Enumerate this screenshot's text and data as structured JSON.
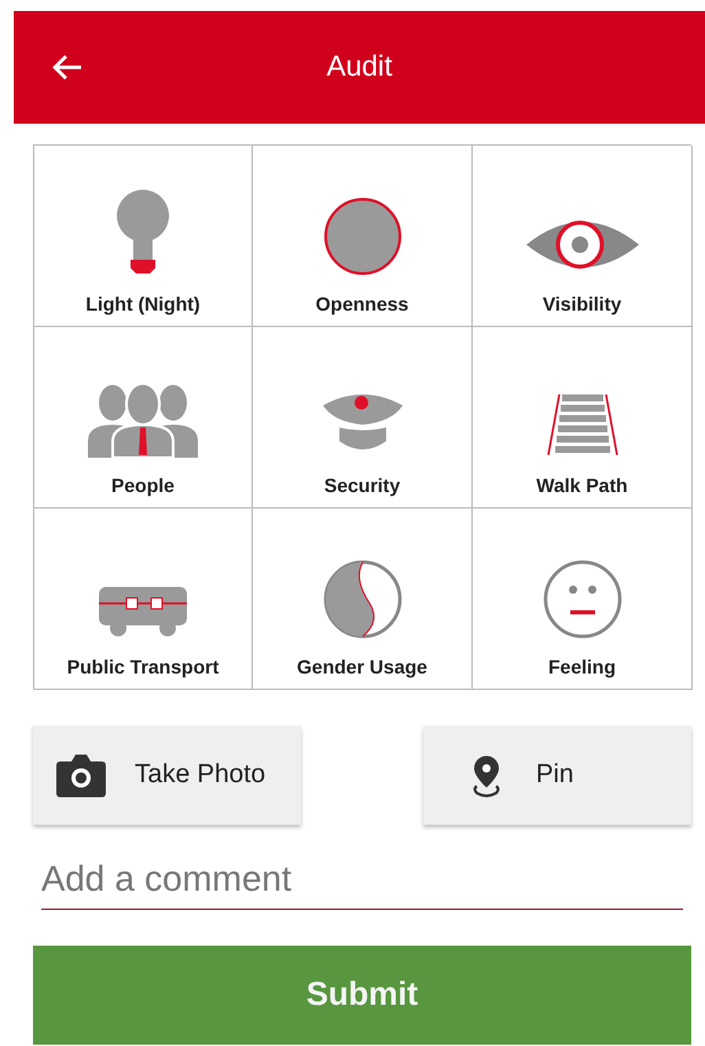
{
  "header": {
    "title": "Audit"
  },
  "categories": [
    {
      "label": "Light (Night)",
      "kind": "bulb"
    },
    {
      "label": "Openness",
      "kind": "circle"
    },
    {
      "label": "Visibility",
      "kind": "eye"
    },
    {
      "label": "People",
      "kind": "people"
    },
    {
      "label": "Security",
      "kind": "cap"
    },
    {
      "label": "Walk Path",
      "kind": "path"
    },
    {
      "label": "Public Transport",
      "kind": "bus"
    },
    {
      "label": "Gender Usage",
      "kind": "yinyang"
    },
    {
      "label": "Feeling",
      "kind": "face"
    }
  ],
  "actions": [
    {
      "label": "Take Photo",
      "kind": "camera"
    },
    {
      "label": "Pin",
      "kind": "pin"
    }
  ],
  "comment": {
    "placeholder": "Add a comment"
  },
  "submit": {
    "label": "Submit"
  }
}
